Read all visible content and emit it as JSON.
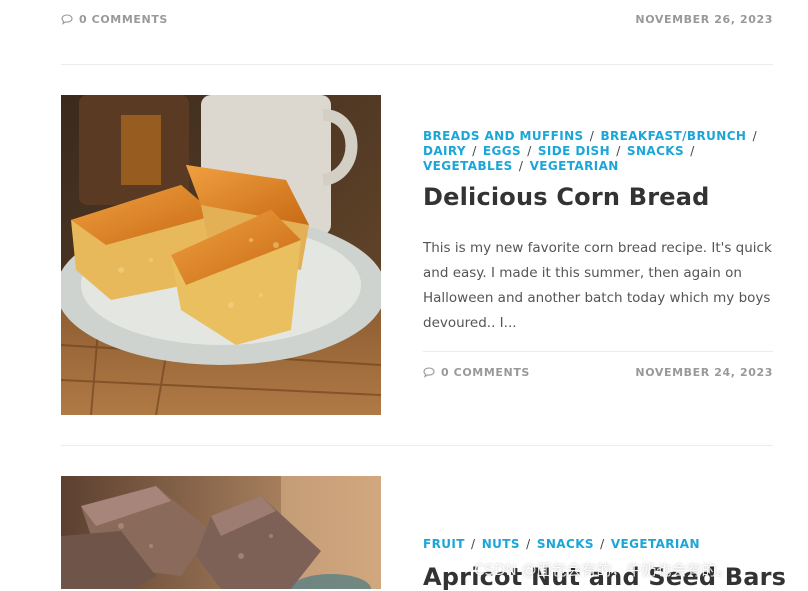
{
  "top_post": {
    "comments": "0 COMMENTS",
    "date": "NOVEMBER 26, 2023"
  },
  "posts": [
    {
      "categories": [
        "BREADS AND MUFFINS",
        "BREAKFAST/BRUNCH",
        "DAIRY",
        "EGGS",
        "SIDE DISH",
        "SNACKS",
        "VEGETABLES",
        "VEGETARIAN"
      ],
      "title": "Delicious Corn Bread",
      "excerpt": "This is my new favorite corn bread recipe. It's quick and easy. I made it this summer, then again on Halloween and another batch today which my boys devoured.. I...",
      "comments": "0 COMMENTS",
      "date": "NOVEMBER 24, 2023",
      "image": "corn-bread-photo"
    },
    {
      "categories": [
        "FRUIT",
        "NUTS",
        "SNACKS",
        "VEGETARIAN"
      ],
      "title": "Apricot Nut and Seed Bars",
      "image": "nut-bars-photo"
    }
  ],
  "category_separator": "/",
  "watermark": "CSDN @面包会有的，牛奶也会有的。",
  "icons": {
    "comment": "comment-bubble-icon"
  },
  "colors": {
    "category_link": "#1ba6d9",
    "meta_text": "#999999",
    "title": "#333333",
    "body_text": "#555555",
    "divider": "#ececec"
  }
}
